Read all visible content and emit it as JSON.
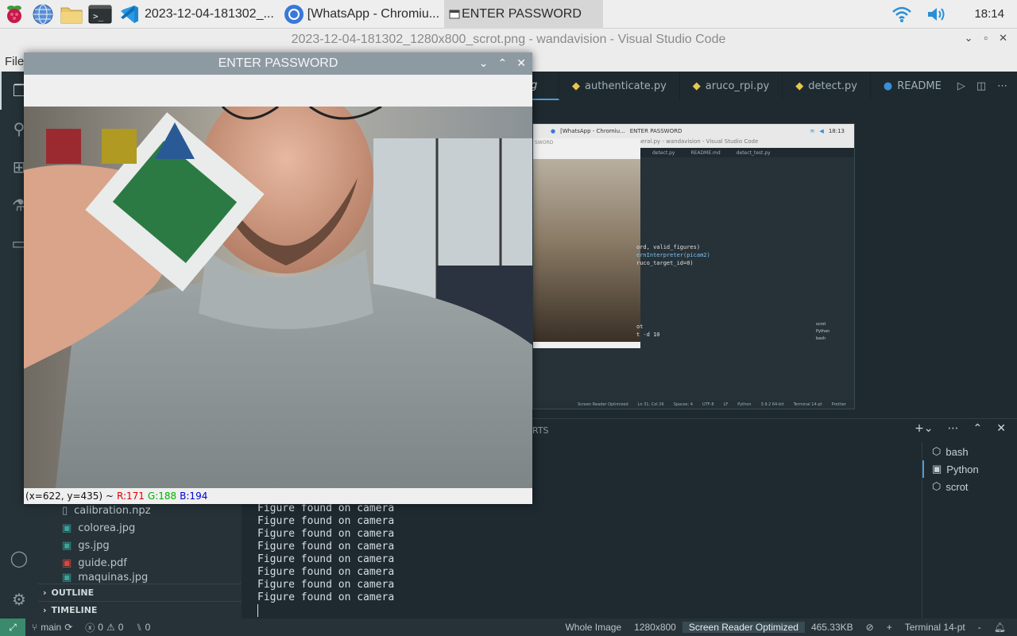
{
  "taskbar": {
    "apps": [
      {
        "label": "2023-12-04-181302_...",
        "icon": "vscode-icon"
      },
      {
        "label": "[WhatsApp - Chromiu...",
        "icon": "chromium-icon"
      },
      {
        "label": "ENTER PASSWORD",
        "icon": "window-icon"
      }
    ],
    "clock": "18:14"
  },
  "vscode": {
    "title": "2023-12-04-181302_1280x800_scrot.png - wandavision - Visual Studio Code",
    "menu_file": "File",
    "tabs": [
      {
        "label": "g",
        "icon": "python-icon"
      },
      {
        "label": "authenticate.py",
        "icon": "python-icon"
      },
      {
        "label": "aruco_rpi.py",
        "icon": "python-icon"
      },
      {
        "label": "detect.py",
        "icon": "python-icon"
      },
      {
        "label": "README",
        "icon": "info-icon"
      }
    ],
    "sidebar_files": [
      {
        "name": "calibration.npz",
        "color": "#8fa9b3"
      },
      {
        "name": "colorea.jpg",
        "color": "#3aa39a"
      },
      {
        "name": "gs.jpg",
        "color": "#3aa39a"
      },
      {
        "name": "guide.pdf",
        "color": "#e0443b"
      },
      {
        "name": "maquinas.jpg",
        "color": "#3aa39a"
      }
    ],
    "outline_label": "OUTLINE",
    "timeline_label": "TIMELINE",
    "panel_tab_fragment": "RTS",
    "terminal_lines": [
      "Figure found on camera",
      "Figure found on camera",
      "Figure found on camera",
      "Figure found on camera",
      "Figure found on camera",
      "Figure found on camera",
      "Figure found on camera",
      "Figure found on camera"
    ],
    "terminal_list": [
      {
        "label": "bash"
      },
      {
        "label": "Python"
      },
      {
        "label": "scrot"
      }
    ],
    "status": {
      "branch": "main",
      "errors": "0",
      "warnings": "0",
      "ports": "0",
      "whole_image": "Whole Image",
      "dims": "1280x800",
      "screen_reader": "Screen Reader Optimized",
      "size": "465.33KB",
      "terminal_font": "Terminal 14-pt",
      "dash": "-",
      "plus": "+"
    }
  },
  "nested_shot": {
    "taskbar_apps": [
      "[WhatsApp - Chromiu...",
      "ENTER PASSWORD"
    ],
    "clock": "18:13",
    "title": "general.py - wandavision - Visual Studio Code",
    "window_label": "SWORD",
    "tabs": [
      "detect.py",
      "README.md",
      "detect_test.py"
    ],
    "code_lines": [
      "ord, valid_figures)",
      "ernInterpreter(picam2)",
      "ruco_target_id=0)"
    ],
    "term_lines": [
      "ot",
      "t -d 10"
    ],
    "term_list": [
      "scrot",
      "Python",
      "bash"
    ],
    "status_items": [
      "Screen Reader Optimized",
      "Ln 31, Col 26",
      "Spaces: 4",
      "UTF-8",
      "LF",
      "Python",
      "3.9.2 64-bit",
      "Terminal 14-pt",
      "Prettier"
    ]
  },
  "cv_window": {
    "title": "ENTER PASSWORD",
    "status_coords": "(x=622, y=435) ~",
    "r": "R:171",
    "g": "G:188",
    "b": "B:194",
    "swatch_colors": [
      "#9b2a30",
      "#b09a22",
      "#2a5a96"
    ]
  }
}
